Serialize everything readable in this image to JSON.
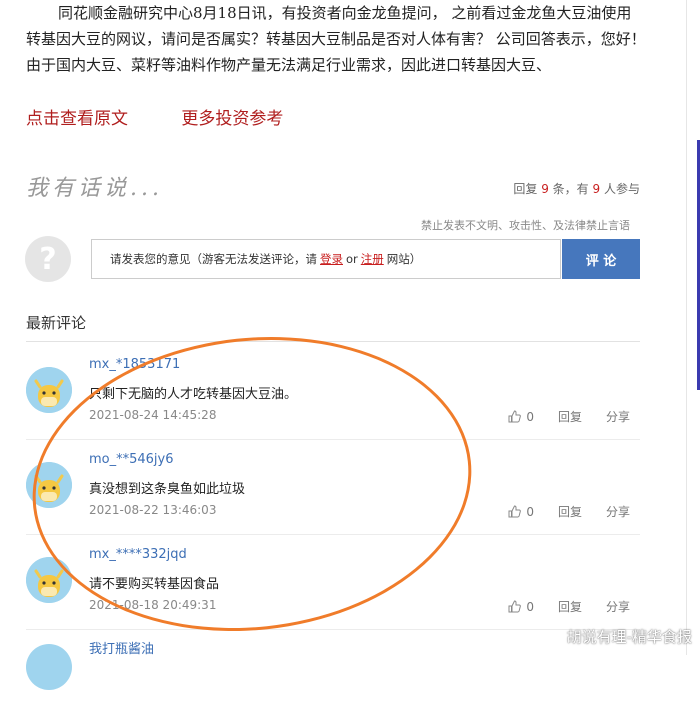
{
  "article": {
    "paragraph": "同花顺金融研究中心8月18日讯，有投资者向金龙鱼提问， 之前看过金龙鱼大豆油使用转基因大豆的网议，请问是否属实？转基因大豆制品是否对人体有害？ 公司回答表示，您好！由于国内大豆、菜籽等油料作物产量无法满足行业需求，因此进口转基因大豆、"
  },
  "links": {
    "view_original": "点击查看原文",
    "more_investment": "更多投资参考"
  },
  "comment_section": {
    "title": "我有话说...",
    "stats": {
      "prefix": "回复",
      "reply_count": "9",
      "mid": "条，有",
      "participant_count": "9",
      "suffix": "人参与"
    },
    "rules": "禁止发表不文明、攻击性、及法律禁止言语",
    "input": {
      "prompt": "请发表您的意见（游客无法发送评论，请",
      "login": "登录",
      "or": "or",
      "register": "注册",
      "suffix": "网站）"
    },
    "submit_label": "评 论",
    "latest_label": "最新评论"
  },
  "comments": [
    {
      "user": "mx_*1853171",
      "text": "只剩下无脑的人才吃转基因大豆油。",
      "time": "2021-08-24 14:45:28",
      "likes": "0",
      "reply": "回复",
      "share": "分享"
    },
    {
      "user": "mo_**546jy6",
      "text": "真没想到这条臭鱼如此垃圾",
      "time": "2021-08-22 13:46:03",
      "likes": "0",
      "reply": "回复",
      "share": "分享"
    },
    {
      "user": "mx_****332jqd",
      "text": "请不要购买转基因食品",
      "time": "2021-08-18 20:49:31",
      "likes": "0",
      "reply": "回复",
      "share": "分享"
    },
    {
      "user": "我打瓶酱油"
    }
  ],
  "watermark": "胡说有理-精华食报",
  "colors": {
    "accent_red": "#b01e1e",
    "button_blue": "#4677bd",
    "username_blue": "#3d6fb5",
    "annotation_orange": "#f07c2a"
  }
}
